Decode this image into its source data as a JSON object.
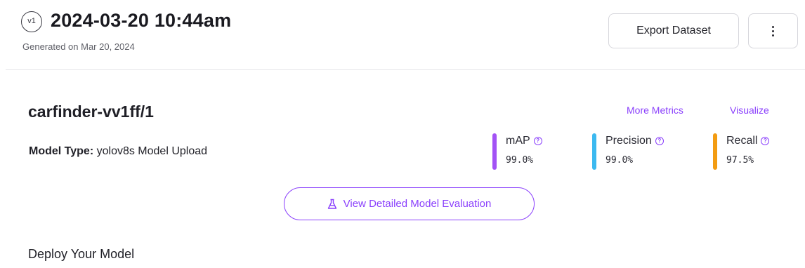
{
  "header": {
    "version": "v1",
    "title": "2024-03-20 10:44am",
    "generated": "Generated on Mar 20, 2024",
    "export_label": "Export Dataset",
    "more_icon": "kebab-menu-icon"
  },
  "model": {
    "name": "carfinder-vv1ff/1",
    "links": {
      "more_metrics": "More Metrics",
      "visualize": "Visualize"
    },
    "type_label": "Model Type:",
    "type_value": "yolov8s Model Upload",
    "metrics": [
      {
        "label": "mAP",
        "value": "99.0%",
        "color": "#a352f5"
      },
      {
        "label": "Precision",
        "value": "99.0%",
        "color": "#3cb9f0"
      },
      {
        "label": "Recall",
        "value": "97.5%",
        "color": "#f39c12"
      }
    ],
    "help_icon": "help-circle-icon",
    "eval_button": "View Detailed Model Evaluation",
    "eval_icon": "flask-icon"
  },
  "deploy": {
    "title": "Deploy Your Model"
  },
  "colors": {
    "accent": "#8a3ffc",
    "divider": "#e4e4e8",
    "text": "#1f1f26"
  }
}
